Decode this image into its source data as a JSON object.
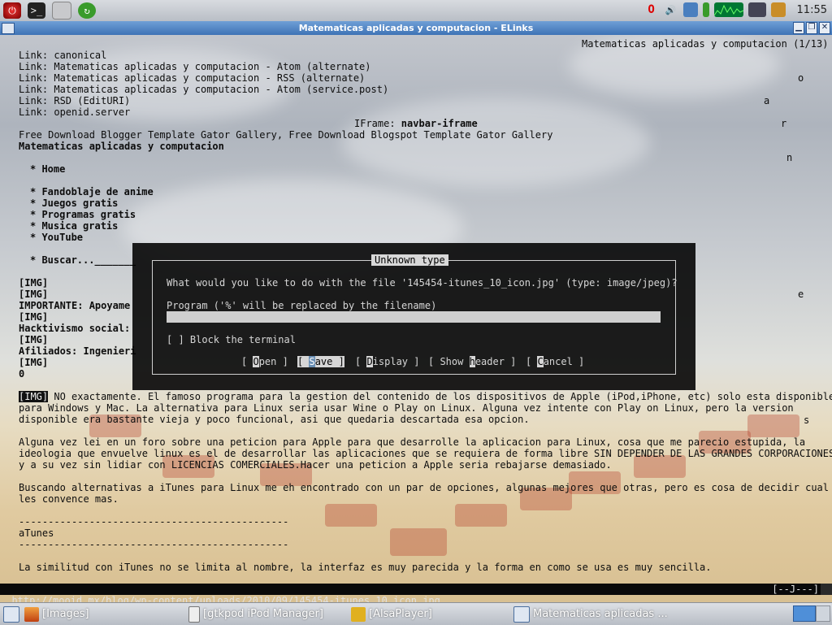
{
  "window": {
    "title": "Matematicas aplicadas y computacion - ELinks",
    "buttons": [
      "▁",
      "❐",
      "✕"
    ]
  },
  "top_panel": {
    "launchers": [
      "power-icon",
      "terminal-icon",
      "file-manager-icon",
      "refresh-icon"
    ],
    "tray": [
      "opera-icon",
      "volume-icon",
      "network-icon",
      "battery-icon",
      "cpu-graph-icon",
      "monitor-icon",
      "package-icon"
    ],
    "clock": "11:55"
  },
  "page": {
    "page_title_indicator": "Matematicas aplicadas y computacion (1/13)",
    "links": [
      {
        "prefix": "Link: ",
        "text": "canonical"
      },
      {
        "prefix": "Link: ",
        "text": "Matematicas aplicadas y computacion - Atom (alternate)"
      },
      {
        "prefix": "Link: ",
        "text": "Matematicas aplicadas y computacion - RSS (alternate)"
      },
      {
        "prefix": "Link: ",
        "text": "Matematicas aplicadas y computacion - Atom (service.post)"
      },
      {
        "prefix": "Link: ",
        "text": "RSD (EditURI)"
      },
      {
        "prefix": "Link: ",
        "text": "openid.server"
      }
    ],
    "iframe_label": "IFrame: ",
    "iframe_name": "navbar-iframe",
    "tagline": "Free Download Blogger Template Gator Gallery, Free Download Blogspot Template Gator Gallery",
    "site_title": "Matematicas aplicadas y computacion",
    "nav": [
      "* Home",
      "* Fandoblaje de anime",
      "* Juegos gratis",
      "* Programas gratis",
      "* Musica gratis",
      "* YouTube",
      "* Buscar..._______"
    ],
    "side_letters": [
      "o",
      "a",
      "r",
      "n",
      "e",
      "s"
    ],
    "left_block": [
      "[IMG]",
      "[IMG]",
      "IMPORTANTE: Apoyame",
      "[IMG]",
      "Hacktivismo social:",
      "[IMG]",
      "Afiliados: Ingenieri",
      "[IMG]",
      "0"
    ],
    "para1_tag": "[IMG]",
    "para1": [
      " NO exactamente. El famoso programa para la gestion del contenido de los dispositivos de Apple (iPod,iPhone, etc) solo esta disponible",
      "para Windows y Mac. La alternativa para Linux seria usar Wine o Play on Linux. Alguna vez intente con Play on Linux, pero la version",
      "disponible era bastante vieja y poco funcional, asi que quedaria descartada esa opcion."
    ],
    "para2": [
      "Alguna vez lei en un foro sobre una peticion para Apple para que desarrolle la aplicacion para Linux, cosa que me parecio estupida, la",
      "ideologia que envuelve linux es el de desarrollar las aplicaciones que se requiera de forma libre SIN DEPENDER DE LAS GRANDES CORPORACIONES",
      "y a su vez sin lidiar con LICENCIAS COMERCIALES.Hacer una peticion a Apple seria rebajarse demasiado."
    ],
    "para3": [
      "Buscando alternativas a iTunes para Linux me eh encontrado con un par de opciones, algunas mejores que otras, pero es cosa de decidir cual",
      "les convence mas."
    ],
    "rule": "----------------------------------------------",
    "section_heading": "aTunes",
    "para4": "La similitud con iTunes no se limita al nombre, la interfaz es muy parecida y la forma en como se usa es muy sencilla."
  },
  "dialog": {
    "title": "Unknown type",
    "question": "What would you like to do with the file '145454-itunes_10_icon.jpg' (type: image/jpeg)?",
    "program_label": "Program ('%' will be replaced by the filename)",
    "program_value": "",
    "block_terminal": "[ ] Block the terminal",
    "buttons": [
      {
        "pre": "[ ",
        "hotkey": "O",
        "rest": "pen",
        "post": " ]"
      },
      {
        "pre": "[ ",
        "hotkey": "S",
        "rest": "ave",
        "post": " ]"
      },
      {
        "pre": "[ ",
        "hotkey": "D",
        "rest": "isplay",
        "post": " ]"
      },
      {
        "pre": "[ Show ",
        "hotkey": "h",
        "rest": "eader",
        "post": " ]"
      },
      {
        "pre": "[ ",
        "hotkey": "C",
        "rest": "ancel",
        "post": " ]"
      }
    ]
  },
  "status_bar": {
    "url": "http://mooid.mx/blog/wp-content/uploads/2010/09/145454-itunes_10_icon.jpg",
    "indicator": "[--J---]"
  },
  "taskbar": {
    "tasks": [
      "[Images]",
      "[gtkpod iPod Manager]",
      "[AlsaPlayer]",
      "Matematicas aplicadas ..."
    ]
  },
  "colors": {
    "title_bar": "#3e73b6",
    "dialog_bg": "#000000",
    "selected_button": "#6a8fb4"
  }
}
